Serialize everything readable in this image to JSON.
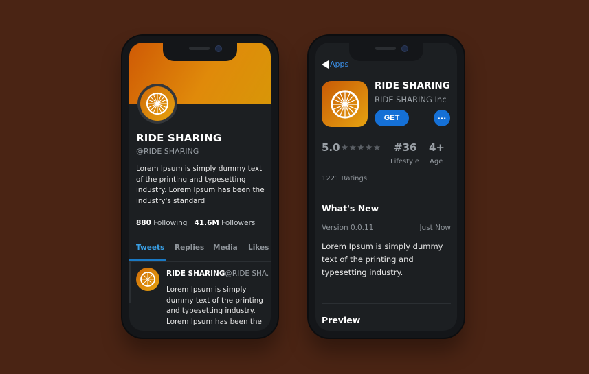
{
  "profile": {
    "name": "RIDE SHARING",
    "handle": "@RIDE SHARING",
    "bio": "Lorem Ipsum is simply dummy text of the printing and typesetting industry. Lorem Ipsum has been the industry's standard",
    "following_count": "880",
    "following_label": "Following",
    "followers_count": "41.6M",
    "followers_label": "Followers",
    "tabs": [
      "Tweets",
      "Replies",
      "Media",
      "Likes"
    ],
    "tweet": {
      "name": "RIDE SHARING",
      "handle": "@RIDE SHA...",
      "body": "Lorem Ipsum is simply dummy text of the printing and typesetting industry. Lorem Ipsum has been the"
    }
  },
  "store": {
    "back_label": "Apps",
    "app_title": "RIDE SHARING",
    "developer": "RIDE SHARING Inc",
    "get_label": "GET",
    "more_label": "···",
    "rating": "5.0",
    "stars": "★★★★★",
    "rank": "#36",
    "rank_category": "Lifestyle",
    "age": "4+",
    "age_label": "Age",
    "ratings_count": "1221 Ratings",
    "whats_new_title": "What's New",
    "version": "Version 0.0.11",
    "updated": "Just Now",
    "release_notes": "Lorem Ipsum is simply dummy text of the printing and typesetting industry.",
    "preview_title": "Preview"
  },
  "colors": {
    "background": "#4a2414",
    "accent": "#1570d6",
    "brand_orange": "#e08a0a"
  }
}
